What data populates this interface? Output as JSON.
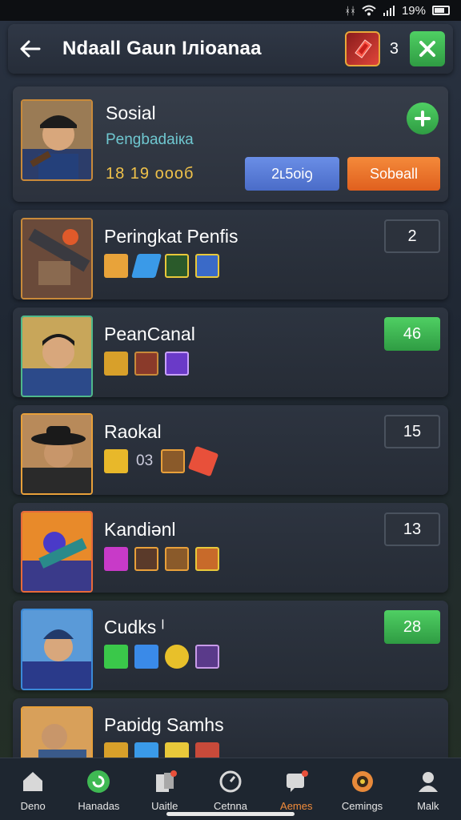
{
  "status_bar": {
    "signal_text": "ᚼᚼ",
    "battery_text": "19%"
  },
  "header": {
    "title": "Ndaall Gaun Iлioanaa",
    "gem_count": "3"
  },
  "profile": {
    "name": "Sosial",
    "subtitle": "Pengbadaiкa",
    "score": "18 19 oooб",
    "primary_button": "2ʟ5oiꝯ",
    "secondary_button": "Sobɵall"
  },
  "rows": [
    {
      "name": "Peringkat Penfis",
      "count": "2",
      "extra_text": ""
    },
    {
      "name": "PeanCanal",
      "count": "46",
      "extra_text": ""
    },
    {
      "name": "Raokal",
      "count": "15",
      "extra_text": "03"
    },
    {
      "name": "Kandiənl",
      "count": "13",
      "extra_text": ""
    },
    {
      "name": "Cudks ˡ",
      "count": "28",
      "extra_text": ""
    },
    {
      "name": "Paɒidg Samhs",
      "count": "",
      "extra_text": ""
    }
  ],
  "nav": [
    {
      "label": "Deno",
      "icon": "home-icon"
    },
    {
      "label": "Hanadas",
      "icon": "refresh-badge-icon"
    },
    {
      "label": "Uaitle",
      "icon": "cards-icon"
    },
    {
      "label": "Cetnna",
      "icon": "compass-icon"
    },
    {
      "label": "Aemes",
      "icon": "chat-icon"
    },
    {
      "label": "Cemings",
      "icon": "target-icon"
    },
    {
      "label": "Malk",
      "icon": "user-icon"
    }
  ],
  "colors": {
    "accent_green": "#3fb953",
    "accent_orange": "#f28c3a",
    "accent_blue": "#5a7fd8",
    "score_gold": "#f0c24a",
    "subtitle_teal": "#6fc7d0"
  }
}
